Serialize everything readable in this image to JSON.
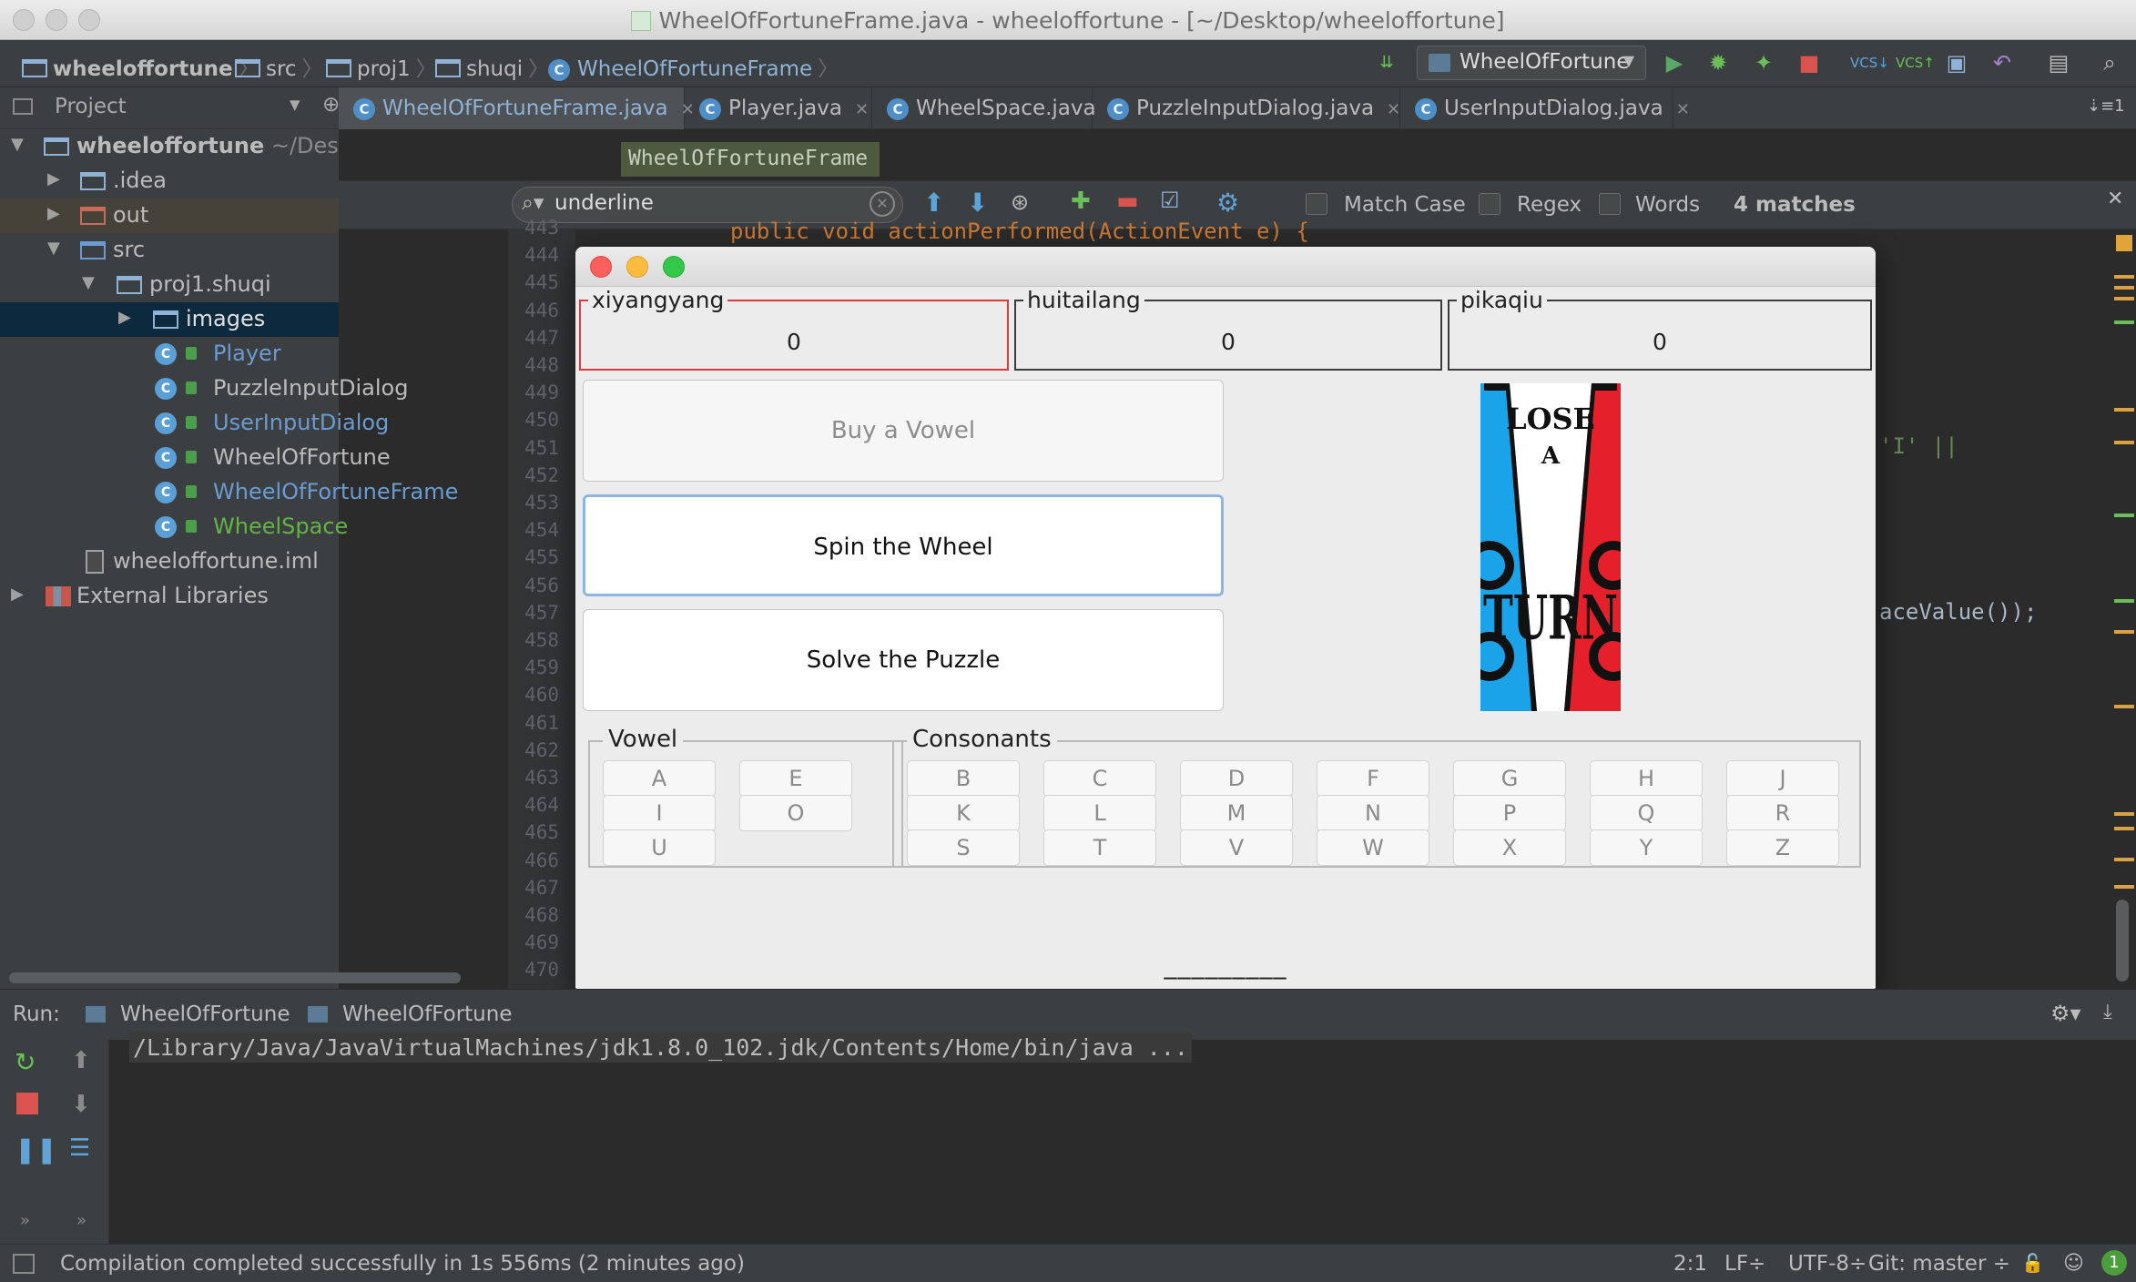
{
  "window": {
    "title": "WheelOfFortuneFrame.java - wheeloffortune - [~/Desktop/wheeloffortune]"
  },
  "navbar": {
    "crumbs": [
      "wheeloffortune",
      "src",
      "proj1",
      "shuqi",
      "WheelOfFortuneFrame"
    ],
    "run_config": "WheelOfFortune"
  },
  "project_panel": {
    "title": "Project",
    "tree": [
      {
        "label": "wheeloffortune",
        "suffix": "~/Desktop/wheeloffortune"
      },
      {
        "label": ".idea"
      },
      {
        "label": "out"
      },
      {
        "label": "src"
      },
      {
        "label": "proj1.shuqi"
      },
      {
        "label": "images"
      },
      {
        "label": "Player"
      },
      {
        "label": "PuzzleInputDialog"
      },
      {
        "label": "UserInputDialog"
      },
      {
        "label": "WheelOfFortune"
      },
      {
        "label": "WheelOfFortuneFrame"
      },
      {
        "label": "WheelSpace"
      },
      {
        "label": "wheeloffortune.iml"
      },
      {
        "label": "External Libraries"
      }
    ]
  },
  "editor": {
    "tabs": [
      {
        "label": "WheelOfFortuneFrame.java"
      },
      {
        "label": "Player.java"
      },
      {
        "label": "WheelSpace.java"
      },
      {
        "label": "PuzzleInputDialog.java"
      },
      {
        "label": "UserInputDialog.java"
      }
    ],
    "tab_overflow": "1",
    "breadcrumb": "WheelOfFortuneFrame",
    "line_numbers": [
      "443",
      "444",
      "445",
      "446",
      "447",
      "448",
      "449",
      "450",
      "451",
      "452",
      "453",
      "454",
      "455",
      "456",
      "457",
      "458",
      "459",
      "460",
      "461",
      "462",
      "463",
      "464",
      "465",
      "466",
      "467",
      "468",
      "469",
      "470"
    ],
    "code_fragments": {
      "top": "public void actionPerformed(ActionEvent e) {",
      "right1": "'I' ||",
      "right2": "aceValue());"
    }
  },
  "find_bar": {
    "query": "underline",
    "match_case": "Match Case",
    "regex": "Regex",
    "words": "Words",
    "matches": "4 matches"
  },
  "game_window": {
    "players": [
      {
        "name": "xiyangyang",
        "score": "0"
      },
      {
        "name": "huitailang",
        "score": "0"
      },
      {
        "name": "pikaqiu",
        "score": "0"
      }
    ],
    "buttons": {
      "buy_vowel": "Buy a Vowel",
      "spin": "Spin the Wheel",
      "solve": "Solve the Puzzle"
    },
    "wheel_space": {
      "line1": "LOSE",
      "line2": "A",
      "line3": "TURN"
    },
    "vowel_group": {
      "title": "Vowel",
      "letters": [
        "A",
        "E",
        "I",
        "O",
        "U"
      ]
    },
    "consonant_group": {
      "title": "Consonants",
      "letters": [
        "B",
        "C",
        "D",
        "F",
        "G",
        "H",
        "J",
        "K",
        "L",
        "M",
        "N",
        "P",
        "Q",
        "R",
        "S",
        "T",
        "V",
        "W",
        "X",
        "Y",
        "Z"
      ]
    },
    "puzzle": "_________"
  },
  "run_panel": {
    "label": "Run:",
    "tabs": [
      "WheelOfFortune",
      "WheelOfFortune"
    ],
    "command": "/Library/Java/JavaVirtualMachines/jdk1.8.0_102.jdk/Contents/Home/bin/java ..."
  },
  "status_bar": {
    "message": "Compilation completed successfully in 1s 556ms (2 minutes ago)",
    "position": "2:1",
    "line_sep": "LF",
    "encoding": "UTF-8",
    "vcs": "Git: master",
    "notifications": "1"
  },
  "colors": {
    "ide_bg": "#2b2b2b",
    "panel_bg": "#3c3f41",
    "accent_blue": "#8fb2d6",
    "active_player_border": "#e03b3b",
    "focus_ring": "#8cb5e3"
  }
}
